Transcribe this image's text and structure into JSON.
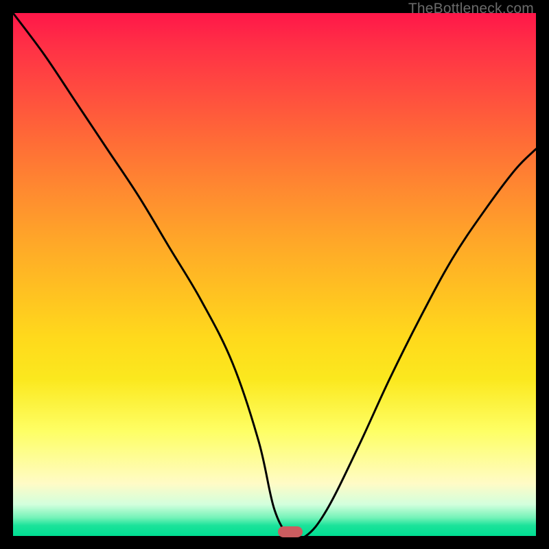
{
  "watermark": "TheBottleneck.com",
  "chart_data": {
    "type": "line",
    "title": "",
    "xlabel": "",
    "ylabel": "",
    "xlim": [
      0,
      100
    ],
    "ylim": [
      0,
      100
    ],
    "grid": false,
    "optimum_x": 53,
    "marker": {
      "x": 53,
      "y": 0,
      "color": "#cb5d60"
    },
    "series": [
      {
        "name": "bottleneck-curve",
        "x": [
          0,
          6,
          12,
          18,
          24,
          30,
          36,
          42,
          47,
          50,
          53,
          56,
          60,
          66,
          72,
          78,
          84,
          90,
          96,
          100
        ],
        "y": [
          100,
          92,
          83,
          74,
          65,
          55,
          45,
          33,
          18,
          5,
          0,
          0,
          5,
          17,
          30,
          42,
          53,
          62,
          70,
          74
        ]
      }
    ],
    "gradient_stops": [
      {
        "pct": 0,
        "color": "#ff1749"
      },
      {
        "pct": 6,
        "color": "#ff2f46"
      },
      {
        "pct": 14,
        "color": "#ff4940"
      },
      {
        "pct": 24,
        "color": "#ff6a37"
      },
      {
        "pct": 34,
        "color": "#ff8a30"
      },
      {
        "pct": 44,
        "color": "#ffa828"
      },
      {
        "pct": 54,
        "color": "#ffc321"
      },
      {
        "pct": 62,
        "color": "#ffd91c"
      },
      {
        "pct": 70,
        "color": "#fbe81e"
      },
      {
        "pct": 80,
        "color": "#feff65"
      },
      {
        "pct": 90,
        "color": "#fffbc6"
      },
      {
        "pct": 94,
        "color": "#d2ffdd"
      },
      {
        "pct": 96.5,
        "color": "#74f3b8"
      },
      {
        "pct": 98,
        "color": "#1be39a"
      },
      {
        "pct": 100,
        "color": "#00de92"
      }
    ]
  }
}
